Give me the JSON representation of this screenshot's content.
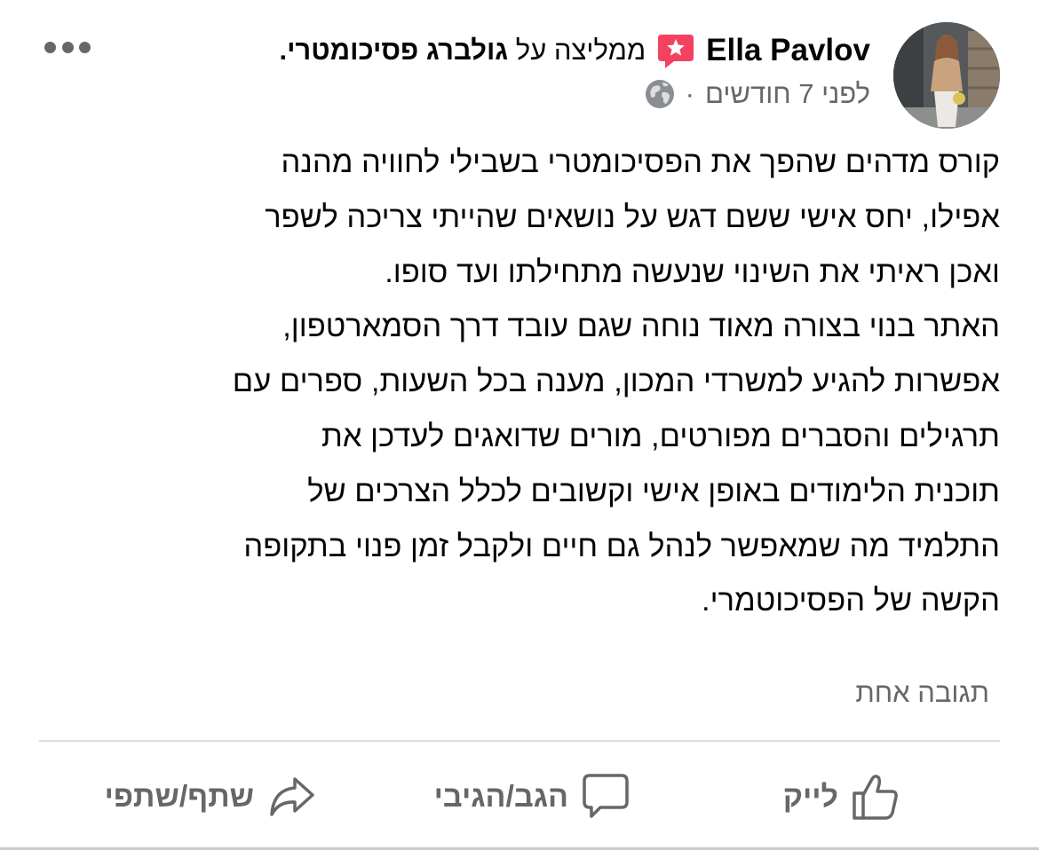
{
  "post": {
    "author": "Ella Pavlov",
    "recommends_prefix": "ממליצה על",
    "page_name": "גולברג פסיכומטרי",
    "page_suffix": ".",
    "time": "לפני 7 חודשים",
    "dot": "·",
    "icons": {
      "recommend": "recommend-badge-icon",
      "audience": "globe-icon",
      "more": "more-options-icon"
    },
    "body_lines": [
      "קורס מדהים שהפך את הפסיכומטרי בשבילי לחוויה מהנה",
      "אפילו, יחס אישי ששם דגש על נושאים שהייתי צריכה לשפר",
      "ואכן ראיתי את השינוי שנעשה מתחילתו ועד סופו.",
      "האתר בנוי בצורה מאוד נוחה שגם עובד דרך הסמארטפון,",
      "אפשרות להגיע למשרדי המכון, מענה בכל השעות, ספרים עם",
      "תרגילים והסברים מפורטים, מורים שדואגים לעדכן את",
      "תוכנית הלימודים באופן אישי וקשובים לכלל הצרכים של",
      "התלמיד מה שמאפשר לנהל גם חיים ולקבל זמן פנוי בתקופה",
      "הקשה של הפסיכוטמרי."
    ],
    "replies": "תגובה אחת"
  },
  "actions": {
    "like": "לייק",
    "comment": "הגב/הגיבי",
    "share": "שתף/שתפי"
  },
  "colors": {
    "text": "#050505",
    "secondary": "#65676b",
    "divider": "#dadde1",
    "recommend_badge": "#f3425f"
  }
}
